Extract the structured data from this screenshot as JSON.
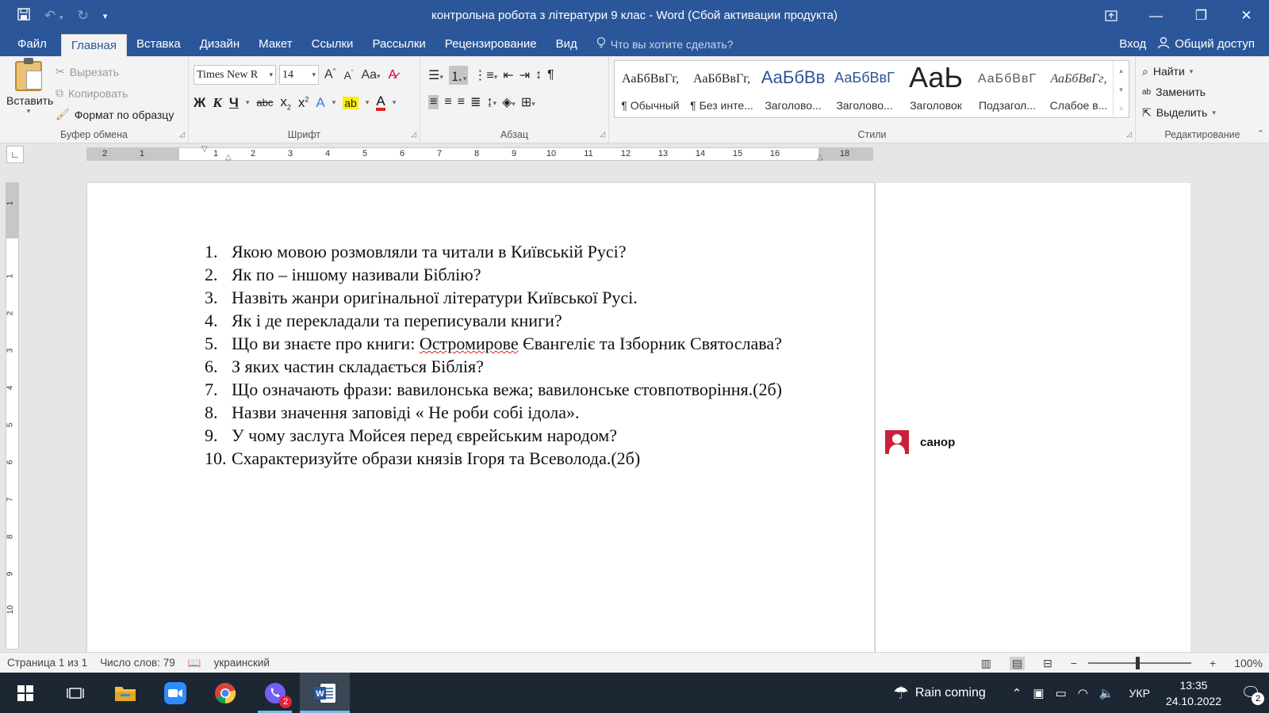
{
  "window": {
    "title": "контрольна робота з літератури 9 клас - Word (Сбой активации продукта)"
  },
  "menu": {
    "file": "Файл",
    "tabs": [
      "Главная",
      "Вставка",
      "Дизайн",
      "Макет",
      "Ссылки",
      "Рассылки",
      "Рецензирование",
      "Вид"
    ],
    "tell_me": "Что вы хотите сделать?",
    "signin": "Вход",
    "share": "Общий доступ"
  },
  "ribbon": {
    "clipboard": {
      "label": "Буфер обмена",
      "paste": "Вставить",
      "cut": "Вырезать",
      "copy": "Копировать",
      "format_painter": "Формат по образцу"
    },
    "font": {
      "label": "Шрифт",
      "name": "Times New R",
      "size": "14"
    },
    "paragraph": {
      "label": "Абзац"
    },
    "styles": {
      "label": "Стили",
      "items": [
        {
          "preview": "АаБбВвГг,",
          "name": "¶ Обычный"
        },
        {
          "preview": "АаБбВвГг,",
          "name": "¶ Без инте..."
        },
        {
          "preview": "АаБбВв",
          "name": "Заголово..."
        },
        {
          "preview": "АаБбВвГ",
          "name": "Заголово..."
        },
        {
          "preview": "АаЬ",
          "name": "Заголовок"
        },
        {
          "preview": "АаБбВвГ",
          "name": "Подзагол..."
        },
        {
          "preview": "АаБбВвГг,",
          "name": "Слабое в..."
        }
      ]
    },
    "editing": {
      "label": "Редактирование",
      "find": "Найти",
      "replace": "Заменить",
      "select": "Выделить"
    }
  },
  "document": {
    "questions": [
      "Якою мовою розмовляли та читали в Київській Русі?",
      "Як по – іншому називали Біблію?",
      "Назвіть жанри оригінальної літератури Київської Русі.",
      "Як і де перекладали та переписували книги?",
      "Що ви знаєте про книги: Остромирове Євангеліє та Ізборник Святослава?",
      "З яких частин складається Біблія?",
      "Що означають фрази: вавилонська вежа; вавилонське стовпотворіння.(2б)",
      "Назви значення заповіді « Не роби собі ідола».",
      "У чому заслуга Мойсея перед єврейським народом?",
      "Схарактеризуйте образи князів Ігоря та Всеволода.(2б)"
    ],
    "numbers": [
      "1.",
      "2.",
      "3.",
      "4.",
      "5.",
      "6.",
      "7.",
      "8.",
      "9.",
      "10."
    ],
    "q5_parts": {
      "before": "Що ви знаєте про книги: ",
      "misspelled": "Остромирове",
      "after": " Євангеліє та Ізборник Святослава?"
    },
    "comment_author": "санор"
  },
  "statusbar": {
    "page": "Страница 1 из 1",
    "words": "Число слов: 79",
    "language": "украинский",
    "zoom": "100%"
  },
  "taskbar": {
    "weather": "Rain coming",
    "language": "УКР",
    "time": "13:35",
    "date": "24.10.2022",
    "viber_badge": "2",
    "notif_badge": "2"
  },
  "colors": {
    "word_blue": "#2b579a",
    "taskbar": "#1c2733",
    "comment_avatar": "#c8203c"
  }
}
